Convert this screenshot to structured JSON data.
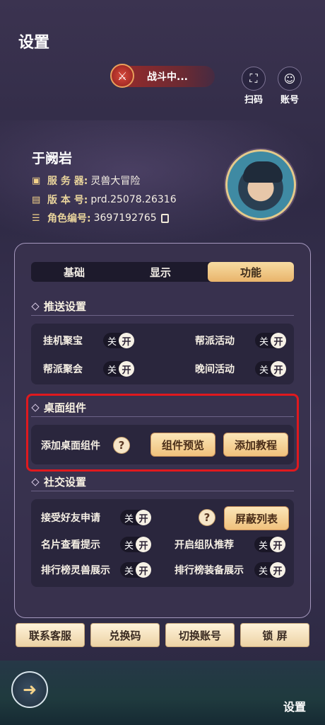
{
  "header": {
    "title": "设置"
  },
  "battle_status": {
    "label": "战斗中..."
  },
  "top_buttons": {
    "scan": "扫码",
    "account": "账号"
  },
  "player": {
    "name": "于阙岩",
    "server_label": "服 务 器:",
    "server_value": "灵兽大冒险",
    "version_label": "版 本 号:",
    "version_value": "prd.25078.26316",
    "role_label": "角色编号:",
    "role_value": "3697192765"
  },
  "tabs": [
    "基础",
    "显示",
    "功能"
  ],
  "push_settings": {
    "title": "推送设置",
    "items": [
      {
        "label": "挂机聚宝",
        "off": "关",
        "on": "开"
      },
      {
        "label": "帮派活动",
        "off": "关",
        "on": "开"
      },
      {
        "label": "帮派聚会",
        "off": "关",
        "on": "开"
      },
      {
        "label": "晚间活动",
        "off": "关",
        "on": "开"
      }
    ]
  },
  "desktop_widget": {
    "title": "桌面组件",
    "label": "添加桌面组件",
    "preview_button": "组件预览",
    "tutorial_button": "添加教程"
  },
  "social_settings": {
    "title": "社交设置",
    "block_list_button": "屏蔽列表",
    "items": [
      {
        "label": "接受好友申请",
        "off": "关",
        "on": "开"
      },
      {
        "label": "名片查看提示",
        "off": "关",
        "on": "开"
      },
      {
        "label": "开启组队推荐",
        "off": "关",
        "on": "开"
      },
      {
        "label": "排行榜灵兽展示",
        "off": "关",
        "on": "开"
      },
      {
        "label": "排行榜装备展示",
        "off": "关",
        "on": "开"
      }
    ]
  },
  "bottom_buttons": [
    "联系客服",
    "兑换码",
    "切换账号",
    "锁 屏"
  ],
  "bottom_bar": {
    "label": "设置"
  },
  "help_glyph": "?"
}
